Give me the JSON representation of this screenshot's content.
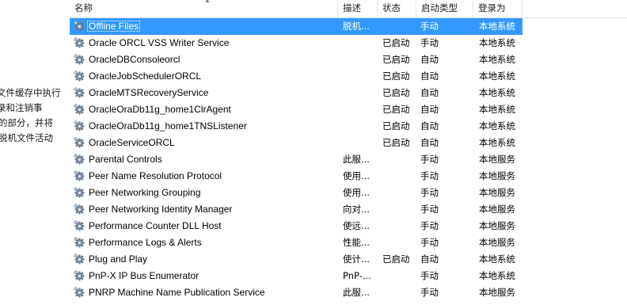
{
  "description_pane": {
    "lines": [
      "文件缓存中执行",
      "录和注销事",
      "的部分，并将",
      "脱机文件活动"
    ]
  },
  "columns": {
    "name": "名称",
    "description": "描述",
    "status": "状态",
    "startup_type": "启动类型",
    "log_on_as": "登录为"
  },
  "rows": [
    {
      "name": "Offline Files",
      "description": "脱机...",
      "status": "",
      "startup_type": "手动",
      "log_on_as": "本地系统",
      "selected": true
    },
    {
      "name": "Oracle ORCL VSS Writer Service",
      "description": "",
      "status": "已启动",
      "startup_type": "手动",
      "log_on_as": "本地系统"
    },
    {
      "name": "OracleDBConsoleorcl",
      "description": "",
      "status": "已启动",
      "startup_type": "自动",
      "log_on_as": "本地系统"
    },
    {
      "name": "OracleJobSchedulerORCL",
      "description": "",
      "status": "已启动",
      "startup_type": "自动",
      "log_on_as": "本地系统"
    },
    {
      "name": "OracleMTSRecoveryService",
      "description": "",
      "status": "已启动",
      "startup_type": "自动",
      "log_on_as": "本地系统"
    },
    {
      "name": "OracleOraDb11g_home1ClrAgent",
      "description": "",
      "status": "已启动",
      "startup_type": "自动",
      "log_on_as": "本地系统"
    },
    {
      "name": "OracleOraDb11g_home1TNSListener",
      "description": "",
      "status": "已启动",
      "startup_type": "自动",
      "log_on_as": "本地系统"
    },
    {
      "name": "OracleServiceORCL",
      "description": "",
      "status": "已启动",
      "startup_type": "自动",
      "log_on_as": "本地系统"
    },
    {
      "name": "Parental Controls",
      "description": "此服...",
      "status": "",
      "startup_type": "手动",
      "log_on_as": "本地服务"
    },
    {
      "name": "Peer Name Resolution Protocol",
      "description": "使用...",
      "status": "",
      "startup_type": "手动",
      "log_on_as": "本地服务"
    },
    {
      "name": "Peer Networking Grouping",
      "description": "使用...",
      "status": "",
      "startup_type": "手动",
      "log_on_as": "本地服务"
    },
    {
      "name": "Peer Networking Identity Manager",
      "description": "向对...",
      "status": "",
      "startup_type": "手动",
      "log_on_as": "本地服务"
    },
    {
      "name": "Performance Counter DLL Host",
      "description": "使远...",
      "status": "",
      "startup_type": "手动",
      "log_on_as": "本地服务"
    },
    {
      "name": "Performance Logs & Alerts",
      "description": "性能...",
      "status": "",
      "startup_type": "手动",
      "log_on_as": "本地服务"
    },
    {
      "name": "Plug and Play",
      "description": "使计...",
      "status": "已启动",
      "startup_type": "自动",
      "log_on_as": "本地系统"
    },
    {
      "name": "PnP-X IP Bus Enumerator",
      "description": "PnP-...",
      "status": "",
      "startup_type": "手动",
      "log_on_as": "本地系统"
    },
    {
      "name": "PNRP Machine Name Publication Service",
      "description": "此服...",
      "status": "",
      "startup_type": "手动",
      "log_on_as": "本地服务"
    }
  ],
  "icons": {
    "service": "gear-icon",
    "sort": "sort-arrow-icon"
  },
  "colors": {
    "selection": "#3399ff"
  }
}
